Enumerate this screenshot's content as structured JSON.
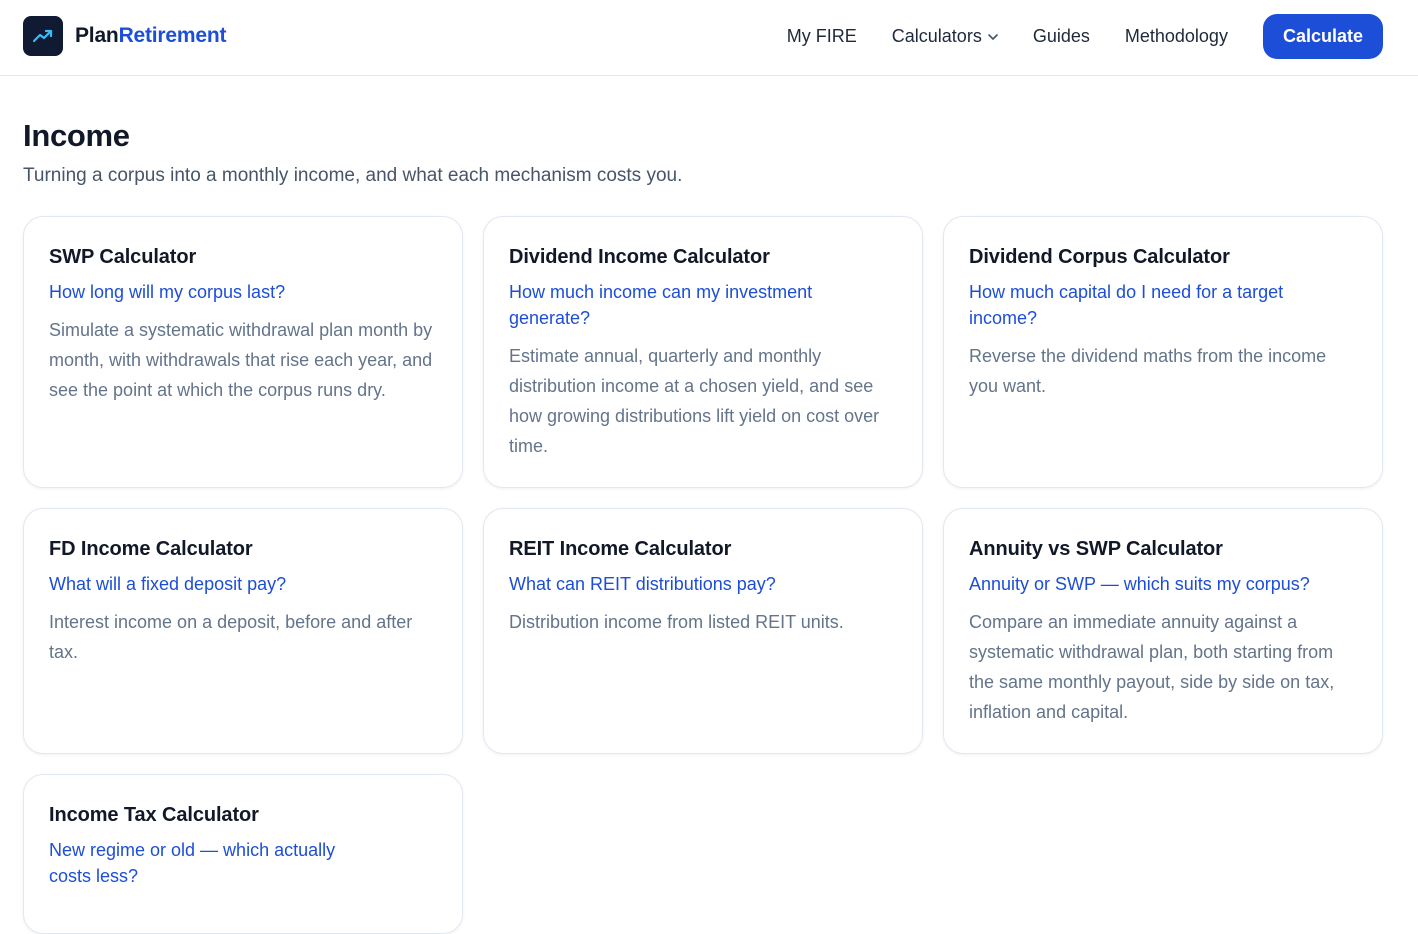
{
  "header": {
    "logo": {
      "part1": "Plan",
      "part2": "Retirement",
      "icon": "trending-up-icon"
    },
    "nav": [
      {
        "label": "My FIRE"
      },
      {
        "label": "Calculators",
        "has_dropdown": true
      },
      {
        "label": "Guides"
      },
      {
        "label": "Methodology"
      }
    ],
    "cta_label": "Calculate"
  },
  "section": {
    "title": "Income",
    "subtitle": "Turning a corpus into a monthly income, and what each mechanism costs you."
  },
  "cards": [
    {
      "title": "SWP Calculator",
      "question": "How long will my corpus last?",
      "description": "Simulate a systematic withdrawal plan month by month, with withdrawals that rise each year, and see the point at which the corpus runs dry."
    },
    {
      "title": "Dividend Income Calculator",
      "question": "How much income can my investment generate?",
      "description": "Estimate annual, quarterly and monthly distribution income at a chosen yield, and see how growing distributions lift yield on cost over time."
    },
    {
      "title": "Dividend Corpus Calculator",
      "question": "How much capital do I need for a target income?",
      "description": "Reverse the dividend maths from the income you want."
    },
    {
      "title": "FD Income Calculator",
      "question": "What will a fixed deposit pay?",
      "description": "Interest income on a deposit, before and after tax."
    },
    {
      "title": "REIT Income Calculator",
      "question": "What can REIT distributions pay?",
      "description": "Distribution income from listed REIT units."
    },
    {
      "title": "Annuity vs SWP Calculator",
      "question": "Annuity or SWP — which suits my corpus?",
      "description": "Compare an immediate annuity against a systematic withdrawal plan, both starting from the same monthly payout, side by side on tax, inflation and capital."
    },
    {
      "title": "Income Tax Calculator",
      "question": "New regime or old — which actually costs less?",
      "description": ""
    }
  ],
  "colors": {
    "accent": "#1d4ed8",
    "logo_bg": "#111a33",
    "text": "#111827",
    "muted": "#64748b"
  }
}
